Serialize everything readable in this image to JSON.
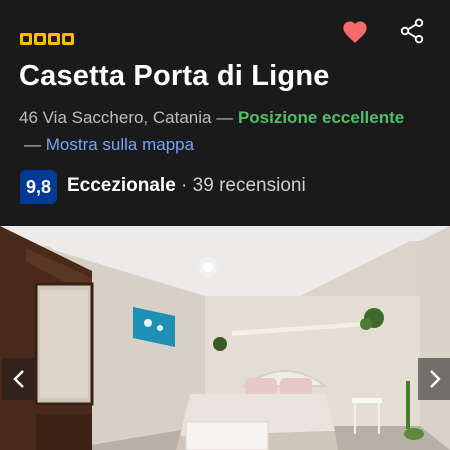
{
  "hotel": {
    "star_count": 4,
    "star_color": "#febb02",
    "name": "Casetta Porta di Ligne",
    "address": "46 Via Sacchero, Catania",
    "separator": " — ",
    "location_badge": "Posizione eccellente",
    "map_link": "Mostra sulla mappa"
  },
  "rating": {
    "score": "9,8",
    "label": "Eccezionale",
    "dot": " · ",
    "reviews": "39 recensioni"
  },
  "icons": {
    "favorite": "heart-icon",
    "share": "share-icon",
    "prev": "chevron-left-icon",
    "next": "chevron-right-icon"
  },
  "colors": {
    "background": "#1a1a1a",
    "heart": "#f36b6b",
    "positive": "#4fbf67",
    "link": "#71a7f5",
    "score_badge": "#003b95"
  }
}
